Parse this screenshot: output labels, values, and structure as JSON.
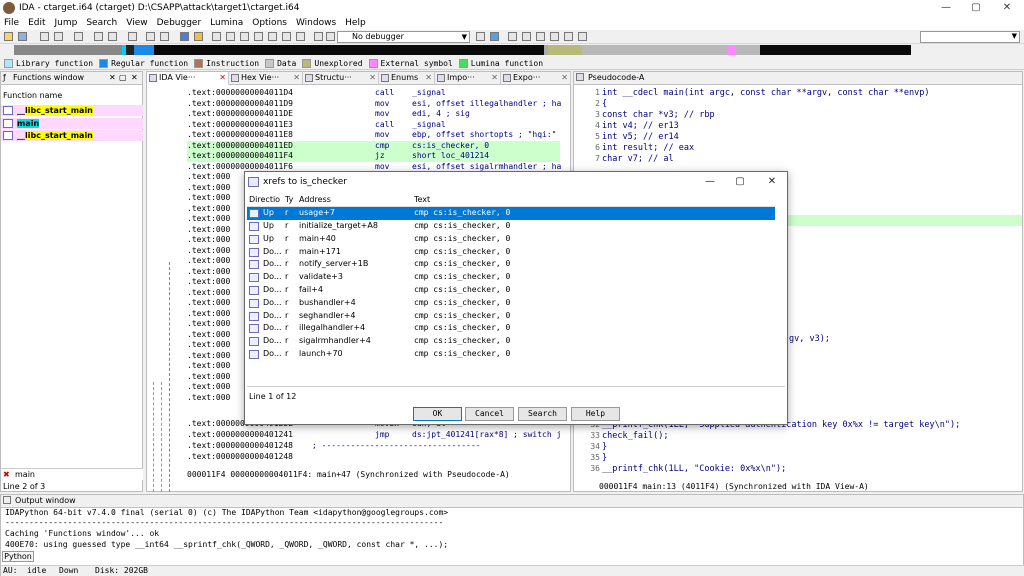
{
  "window": {
    "title": "IDA - ctarget.i64 (ctarget) D:\\CSAPP\\attack\\target1\\ctarget.i64",
    "minimize": "—",
    "maximize": "▢",
    "close": "✕"
  },
  "menu": [
    "File",
    "Edit",
    "Jump",
    "Search",
    "View",
    "Debugger",
    "Lumina",
    "Options",
    "Windows",
    "Help"
  ],
  "toolbar": {
    "debugger": "No debugger"
  },
  "legend": [
    {
      "label": "Library function",
      "color": "#aee8ff"
    },
    {
      "label": "Regular function",
      "color": "#1e88e5"
    },
    {
      "label": "Instruction",
      "color": "#b0715a"
    },
    {
      "label": "Data",
      "color": "#c8c8c8"
    },
    {
      "label": "Unexplored",
      "color": "#b8b87a"
    },
    {
      "label": "External symbol",
      "color": "#ff88ff"
    },
    {
      "label": "Lumina function",
      "color": "#44dd66"
    }
  ],
  "functions_window": {
    "tab": "Functions window",
    "header": "Function name",
    "items": [
      {
        "pre": "__",
        "hl": "libc_start_main",
        "hlclass": "hl-yellow"
      },
      {
        "pre": "",
        "hl": "main",
        "hlclass": "hl-cyan"
      },
      {
        "pre": "__",
        "hl": "libc_start_main",
        "hlclass": "hl-yellow"
      }
    ],
    "search_value": "main",
    "line_info": "Line 2 of 3"
  },
  "tabs": [
    "IDA Vie···",
    "Hex Vie···",
    "Structu···",
    "Enums",
    "Impo···",
    "Expo···"
  ],
  "ida_view": {
    "rows": [
      {
        "addr": ".text:00000000004011D4",
        "mnem": "call",
        "ops": "_signal"
      },
      {
        "addr": ".text:00000000004011D9",
        "mnem": "mov",
        "ops": "esi, offset illegalhandler ; ha"
      },
      {
        "addr": ".text:00000000004011DE",
        "mnem": "mov",
        "ops": "edi, 4           ; sig"
      },
      {
        "addr": ".text:00000000004011E3",
        "mnem": "call",
        "ops": "_signal"
      },
      {
        "addr": ".text:00000000004011E8",
        "mnem": "mov",
        "ops": "ebp, offset shortopts ; \"hqi:\""
      },
      {
        "addr": ".text:00000000004011ED",
        "mnem": "cmp",
        "ops": "cs:is_checker, 0"
      },
      {
        "addr": ".text:00000000004011F4",
        "mnem": "jz",
        "ops": "short loc_401214"
      },
      {
        "addr": ".text:00000000004011F6",
        "mnem": "mov",
        "ops": "esi, offset sigalrmhandler ; ha"
      },
      {
        "addr": ".text:000",
        "mnem": "",
        "ops": ""
      },
      {
        "addr": ".text:000",
        "mnem": "",
        "ops": ""
      },
      {
        "addr": ".text:000",
        "mnem": "",
        "ops": ""
      },
      {
        "addr": ".text:000",
        "mnem": "",
        "ops": ""
      },
      {
        "addr": ".text:000",
        "mnem": "",
        "ops": ""
      },
      {
        "addr": ".text:000",
        "mnem": "",
        "ops": ""
      },
      {
        "addr": ".text:000",
        "mnem": "",
        "ops": ""
      },
      {
        "addr": ".text:000",
        "mnem": "",
        "ops": ""
      },
      {
        "addr": ".text:000",
        "mnem": "",
        "ops": ""
      },
      {
        "addr": ".text:000",
        "mnem": "",
        "ops": ""
      },
      {
        "addr": ".text:000",
        "mnem": "",
        "ops": ""
      },
      {
        "addr": ".text:000",
        "mnem": "",
        "ops": ""
      },
      {
        "addr": ".text:000",
        "mnem": "",
        "ops": ""
      },
      {
        "addr": ".text:000",
        "mnem": "",
        "ops": ""
      },
      {
        "addr": ".text:000",
        "mnem": "",
        "ops": ""
      },
      {
        "addr": ".text:000",
        "mnem": "",
        "ops": ""
      },
      {
        "addr": ".text:000",
        "mnem": "",
        "ops": ""
      },
      {
        "addr": ".text:000",
        "mnem": "",
        "ops": ""
      },
      {
        "addr": ".text:000",
        "mnem": "",
        "ops": ""
      },
      {
        "addr": ".text:000",
        "mnem": "",
        "ops": ""
      },
      {
        "addr": ".text:000",
        "mnem": "",
        "ops": ""
      },
      {
        "addr": ".text:000",
        "mnem": "",
        "ops": ""
      },
      {
        "addr": ".text:000000000040123E",
        "mnem": "movzx",
        "ops": "eax, al"
      },
      {
        "addr": ".text:0000000000401241",
        "mnem": "jmp",
        "ops": "ds:jpt_401241[rax*8] ; switch j"
      },
      {
        "addr": ".text:0000000000401248",
        "mnem": "",
        "ops": "; ---------------------------------"
      },
      {
        "addr": ".text:0000000000401248",
        "mnem": "",
        "ops": ""
      }
    ],
    "status": "000011F4 00000000004011F4: main+47 (Synchronized with Pseudocode-A)"
  },
  "pseudocode": {
    "tab": "Pseudocode-A",
    "lines": [
      {
        "n": "1",
        "code": "int __cdecl main(int argc, const char **argv, const char **envp)"
      },
      {
        "n": "2",
        "code": "{"
      },
      {
        "n": "3",
        "code": "  const char *v3; // rbp"
      },
      {
        "n": "4",
        "code": "  int v4; // er13"
      },
      {
        "n": "5",
        "code": "  int v5; // er14"
      },
      {
        "n": "6",
        "code": "  int result; // eax"
      },
      {
        "n": "7",
        "code": "  char v7; // al"
      }
    ],
    "fragment": "gv, v3);",
    "lower": [
      {
        "n": "32",
        "code": "        __printf_chk(1LL, \"Supplied authentication key 0x%x != target key\\n\");"
      },
      {
        "n": "33",
        "code": "        check_fail();"
      },
      {
        "n": "34",
        "code": "      }"
      },
      {
        "n": "35",
        "code": "    }"
      },
      {
        "n": "36",
        "code": "    __printf_chk(1LL, \"Cookie: 0x%x\\n\");"
      }
    ],
    "status": "000011F4 main:13 (4011F4) (Synchronized with IDA View-A)"
  },
  "xrefs": {
    "title": "xrefs to is_checker",
    "columns": [
      "Directio",
      "Ty",
      "Address",
      "Text"
    ],
    "rows": [
      {
        "dir": "Up",
        "type": "r",
        "addr": "usage+7",
        "text": "cmp    cs:is_checker, 0"
      },
      {
        "dir": "Up",
        "type": "r",
        "addr": "initialize_target+A8",
        "text": "cmp    cs:is_checker, 0"
      },
      {
        "dir": "Up",
        "type": "r",
        "addr": "main+40",
        "text": "cmp    cs:is_checker, 0"
      },
      {
        "dir": "Do...",
        "type": "r",
        "addr": "main+171",
        "text": "cmp    cs:is_checker, 0"
      },
      {
        "dir": "Do...",
        "type": "r",
        "addr": "notify_server+1B",
        "text": "cmp    cs:is_checker, 0"
      },
      {
        "dir": "Do...",
        "type": "r",
        "addr": "validate+3",
        "text": "cmp    cs:is_checker, 0"
      },
      {
        "dir": "Do...",
        "type": "r",
        "addr": "fail+4",
        "text": "cmp    cs:is_checker, 0"
      },
      {
        "dir": "Do...",
        "type": "r",
        "addr": "bushandler+4",
        "text": "cmp    cs:is_checker, 0"
      },
      {
        "dir": "Do...",
        "type": "r",
        "addr": "seghandler+4",
        "text": "cmp    cs:is_checker, 0"
      },
      {
        "dir": "Do...",
        "type": "r",
        "addr": "illegalhandler+4",
        "text": "cmp    cs:is_checker, 0"
      },
      {
        "dir": "Do...",
        "type": "r",
        "addr": "sigalrmhandler+4",
        "text": "cmp    cs:is_checker, 0"
      },
      {
        "dir": "Do...",
        "type": "r",
        "addr": "launch+70",
        "text": "cmp    cs:is_checker, 0"
      }
    ],
    "line_info": "Line 1 of 12",
    "buttons": {
      "ok": "OK",
      "cancel": "Cancel",
      "search": "Search",
      "help": "Help"
    }
  },
  "output": {
    "tab": "Output window",
    "lines": [
      "IDAPython 64-bit v7.4.0 final (serial 0) (c) The IDAPython Team <idapython@googlegroups.com>",
      "-------------------------------------------------------------------------------------------",
      "Caching 'Functions window'... ok",
      "400E70: using guessed type __int64 __sprintf_chk(_QWORD, _QWORD, _QWORD, const char *, ...);"
    ],
    "python_button": "Python"
  },
  "status": {
    "au": "AU:",
    "state": "idle",
    "direction": "Down",
    "disk": "Disk: 202GB"
  }
}
